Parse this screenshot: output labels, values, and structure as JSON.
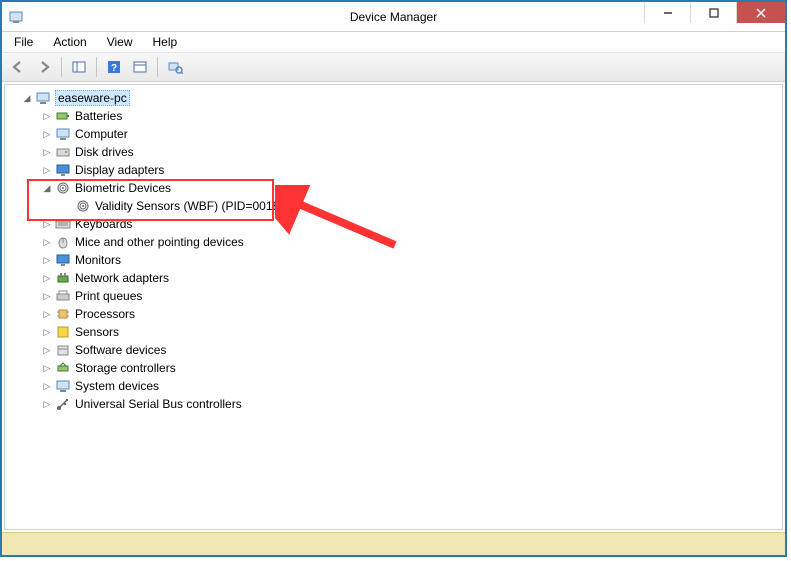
{
  "window": {
    "title": "Device Manager"
  },
  "menubar": {
    "file": "File",
    "action": "Action",
    "view": "View",
    "help": "Help"
  },
  "tree": {
    "root": "easeware-pc",
    "batteries": "Batteries",
    "computer": "Computer",
    "disk_drives": "Disk drives",
    "display_adapters": "Display adapters",
    "biometric_devices": "Biometric Devices",
    "validity_sensors": "Validity Sensors (WBF) (PID=0018)",
    "keyboards": "Keyboards",
    "mice": "Mice and other pointing devices",
    "monitors": "Monitors",
    "network_adapters": "Network adapters",
    "print_queues": "Print queues",
    "processors": "Processors",
    "sensors": "Sensors",
    "software_devices": "Software devices",
    "storage_controllers": "Storage controllers",
    "system_devices": "System devices",
    "usb": "Universal Serial Bus controllers"
  }
}
